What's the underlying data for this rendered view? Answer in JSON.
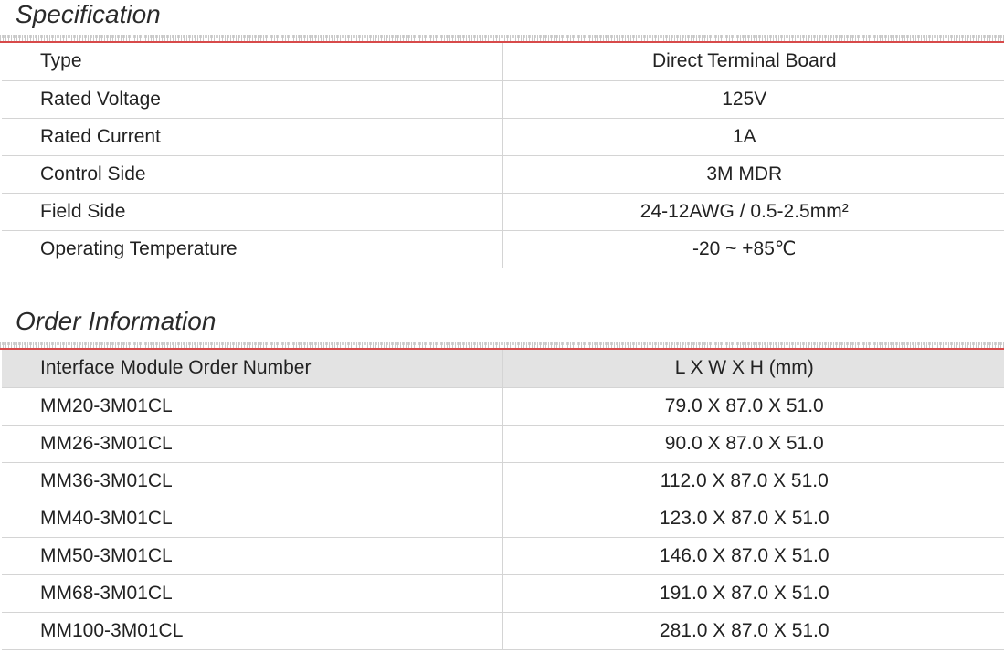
{
  "specification": {
    "title": "Specification",
    "rows": [
      {
        "label": "Type",
        "value": "Direct Terminal Board"
      },
      {
        "label": "Rated Voltage",
        "value": "125V"
      },
      {
        "label": "Rated Current",
        "value": "1A"
      },
      {
        "label": "Control Side",
        "value": "3M MDR"
      },
      {
        "label": "Field Side",
        "value": "24-12AWG / 0.5-2.5mm²"
      },
      {
        "label": "Operating Temperature",
        "value": "-20 ~ +85℃"
      }
    ]
  },
  "order_information": {
    "title": "Order Information",
    "header": {
      "col1": "Interface Module Order Number",
      "col2": "L X W X H (mm)"
    },
    "rows": [
      {
        "model": "MM20-3M01CL",
        "dimensions": "79.0 X 87.0 X 51.0"
      },
      {
        "model": "MM26-3M01CL",
        "dimensions": "90.0 X 87.0 X 51.0"
      },
      {
        "model": "MM36-3M01CL",
        "dimensions": "112.0 X 87.0 X 51.0"
      },
      {
        "model": "MM40-3M01CL",
        "dimensions": "123.0 X 87.0 X 51.0"
      },
      {
        "model": "MM50-3M01CL",
        "dimensions": "146.0 X 87.0 X 51.0"
      },
      {
        "model": "MM68-3M01CL",
        "dimensions": "191.0 X 87.0 X 51.0"
      },
      {
        "model": "MM100-3M01CL",
        "dimensions": "281.0 X 87.0 X 51.0"
      }
    ]
  },
  "colors": {
    "accent_rule": "#d84a4a",
    "header_bg": "#e3e3e3",
    "grid_line": "#d4d4d4"
  }
}
